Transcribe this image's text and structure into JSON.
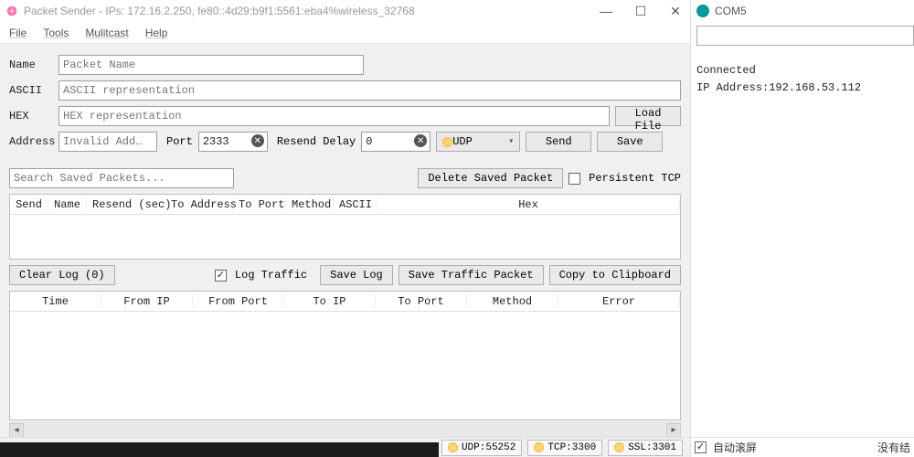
{
  "main": {
    "title": "Packet Sender - IPs: 172.16.2.250, fe80::4d29:b9f1:5561:eba4%wireless_32768",
    "menu": {
      "file": "File",
      "tools": "Tools",
      "multicast": "Mulitcast",
      "help": "Help"
    },
    "form": {
      "name_label": "Name",
      "name_placeholder": "Packet Name",
      "ascii_label": "ASCII",
      "ascii_placeholder": "ASCII representation",
      "hex_label": "HEX",
      "hex_placeholder": "HEX representation",
      "load_file": "Load File",
      "address_label": "Address",
      "address_placeholder": "Invalid Add…",
      "port_label": "Port",
      "port_value": "2333",
      "resend_label": "Resend Delay",
      "resend_value": "0",
      "protocol": "UDP",
      "send": "Send",
      "save": "Save"
    },
    "search": {
      "placeholder": "Search Saved Packets...",
      "delete_btn": "Delete Saved Packet",
      "persistent_tcp": "Persistent TCP"
    },
    "packets_table": {
      "columns": [
        "Send",
        "Name",
        "Resend (sec)",
        "To Address",
        "To Port",
        "Method",
        "ASCII",
        "Hex"
      ]
    },
    "log_controls": {
      "clear_log": "Clear Log (0)",
      "log_traffic": "Log Traffic",
      "save_log": "Save Log",
      "save_traffic": "Save Traffic Packet",
      "copy_clip": "Copy to Clipboard"
    },
    "log_table": {
      "columns": [
        "Time",
        "From IP",
        "From Port",
        "To IP",
        "To Port",
        "Method",
        "Error"
      ]
    },
    "status": {
      "udp": "UDP:55252",
      "tcp": "TCP:3300",
      "ssl": "SSL:3301"
    }
  },
  "side": {
    "title": "COM5",
    "connected": "Connected",
    "ip_line": "IP Address:192.168.53.112",
    "autoscroll": "自动滚屏",
    "tail": "没有结"
  }
}
